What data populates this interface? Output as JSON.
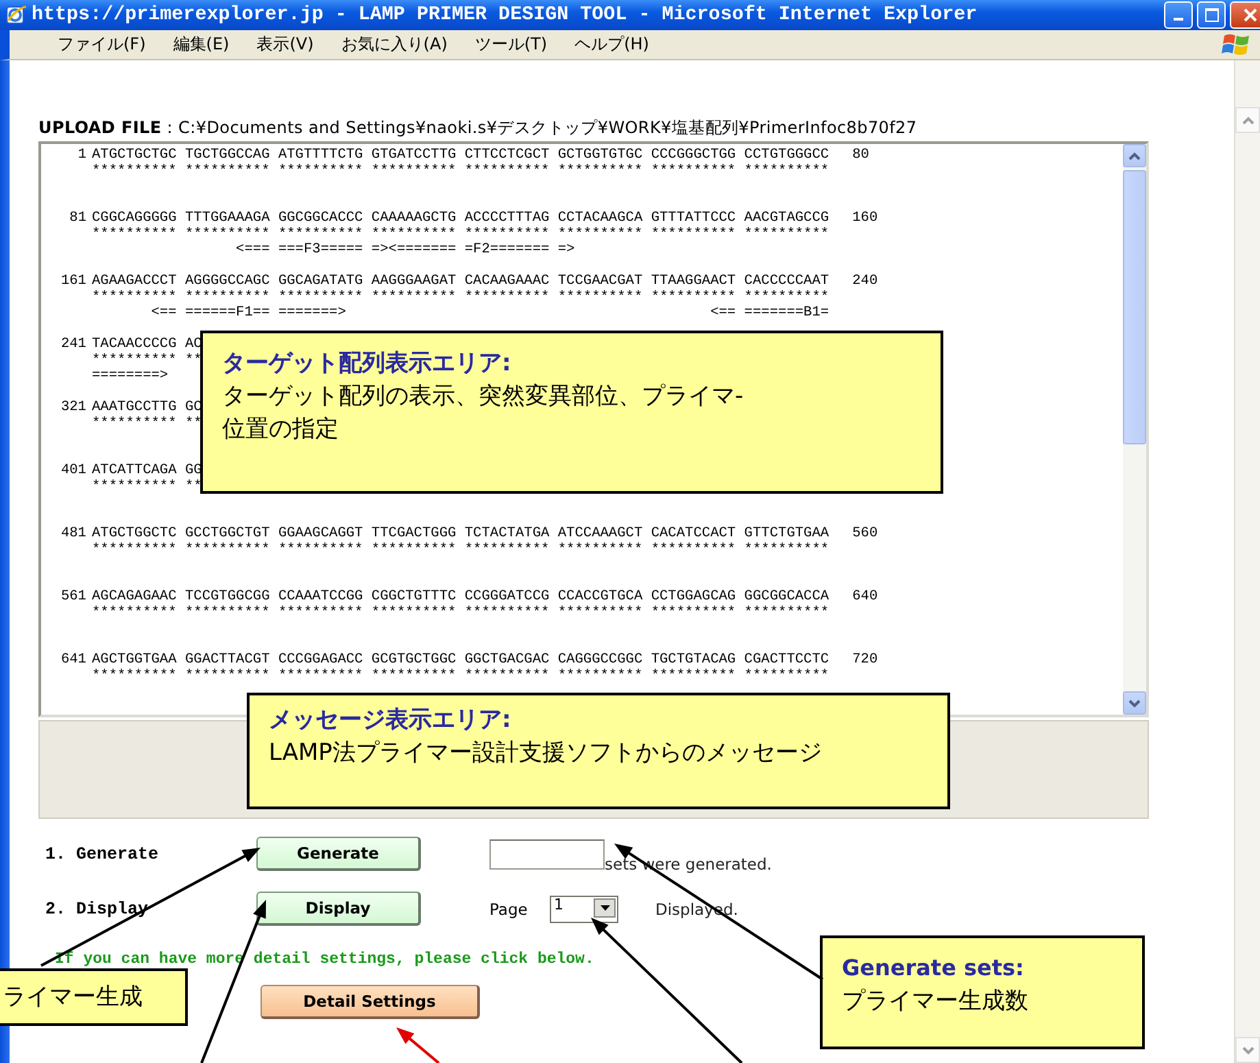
{
  "window": {
    "title": "https://primerexplorer.jp - LAMP PRIMER DESIGN TOOL - Microsoft Internet Explorer"
  },
  "menu": [
    "ファイル(F)",
    "編集(E)",
    "表示(V)",
    "お気に入り(A)",
    "ツール(T)",
    "ヘルプ(H)"
  ],
  "upload": "**UPLOAD FILE** : C:¥Documents and Settings¥naoki.s¥デスクトップ¥WORK¥塩基配列¥PrimerInfoc8b70f27",
  "sequence": {
    "rows": [
      {
        "start": "1",
        "bases": "ATGCTGCTGC TGCTGGCCAG ATGTTTTCTG GTGATCCTTG CTTCCTCGCT GCTGGTGTGC CCCGGGCTGG CCTGTGGGCC",
        "end": "80",
        "stars": "********** ********** ********** ********** ********** ********** ********** **********"
      },
      {
        "start": "81",
        "bases": "CGGCAGGGGG TTTGGAAAGA GGCGGCACCC CAAAAAGCTG ACCCCTTTAG CCTACAAGCA GTTTATTCCC AACGTAGCCG",
        "end": "160",
        "stars": "********** ********** ********** ********** ********** ********** ********** **********",
        "annotation": "                 <=== ===F3===== =><======= =F2======= =>"
      },
      {
        "start": "161",
        "bases": "AGAAGACCCT AGGGGCCAGC GGCAGATATG AAGGGAAGAT CACAAGAAAC TCCGAACGAT TTAAGGAACT CACCCCCAAT",
        "end": "240",
        "stars": "********** ********** ********** ********** ********** ********** ********** **********",
        "annotation": "       <== ======F1== =======>                                           <== =======B1="
      },
      {
        "start": "241",
        "bases": "TACAACCCCG AC",
        "stars": "********** **",
        "annotation": "========>"
      },
      {
        "start": "321",
        "bases": "AAATGCCTTG GC",
        "stars": "********** **"
      },
      {
        "start": "401",
        "bases": "ATCATTCAGA GG",
        "stars": "********** **"
      },
      {
        "start": "481",
        "bases": "ATGCTGGCTC GCCTGGCTGT GGAAGCAGGT TTCGACTGGG TCTACTATGA ATCCAAAGCT CACATCCACT GTTCTGTGAA",
        "end": "560",
        "stars": "********** ********** ********** ********** ********** ********** ********** **********"
      },
      {
        "start": "561",
        "bases": "AGCAGAGAAC TCCGTGGCGG CCAAATCCGG CGGCTGTTTC CCGGGATCCG CCACCGTGCA CCTGGAGCAG GGCGGCACCA",
        "end": "640",
        "stars": "********** ********** ********** ********** ********** ********** ********** **********"
      },
      {
        "start": "641",
        "bases": "AGCTGGTGAA GGACTTACGT CCCGGAGACC GCGTGCTGGC GGCTGACGAC CAGGGCCGGC TGCTGTACAG CGACTTCCTC",
        "end": "720",
        "stars": "********** ********** ********** ********** ********** ********** ********** **********"
      }
    ]
  },
  "form": {
    "generate": {
      "label": "1. Generate",
      "button": "Generate",
      "suffix": "sets were generated."
    },
    "display": {
      "label": "2. Display",
      "button": "Display",
      "page_label": "Page",
      "page_value": "1",
      "suffix": "Displayed."
    },
    "hint": "If you can have more detail settings, please click below.",
    "detail_button": "Detail Settings"
  },
  "callouts": [
    {
      "title": "ターゲット配列表示エリア:",
      "text": "ターゲット配列の表示、突然変異部位、プライマ-\n位置の指定"
    },
    {
      "title": "メッセージ表示エリア:",
      "text": "LAMP法プライマー設計支援ソフトからのメッセージ"
    },
    {
      "text": "ライマー生成"
    },
    {
      "title": "Generate sets:",
      "text": "プライマー生成数"
    }
  ]
}
